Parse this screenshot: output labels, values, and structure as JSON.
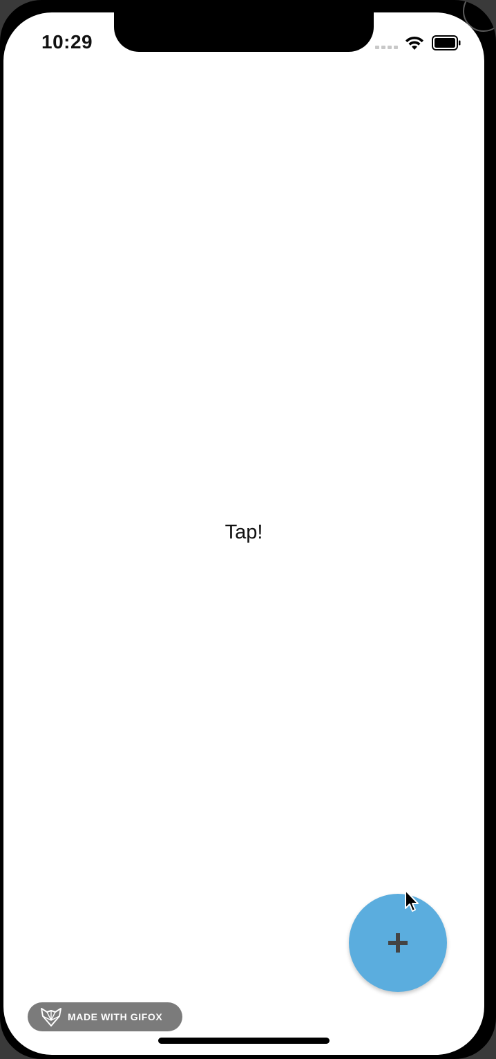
{
  "status_bar": {
    "time": "10:29",
    "icons": [
      "cellular-signal-icon",
      "wifi-icon",
      "battery-icon"
    ]
  },
  "main": {
    "center_label": "Tap!"
  },
  "fab": {
    "icon": "plus-icon",
    "color": "#5badde",
    "icon_color": "#444444"
  },
  "watermark": {
    "label": "MADE WITH GIFOX",
    "icon": "fox-icon"
  },
  "colors": {
    "background": "#ffffff",
    "device_frame": "#000000"
  }
}
